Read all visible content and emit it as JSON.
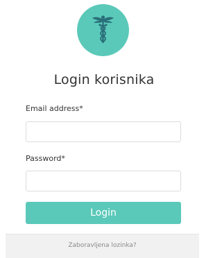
{
  "logo": {
    "icon": "caduceus-icon",
    "background_color": "#5bc9b9"
  },
  "login": {
    "title": "Login korisnika",
    "email_label": "Email address*",
    "email_value": "",
    "password_label": "Password*",
    "password_value": "",
    "submit_label": "Login",
    "forgot_password_link": "Zaboravljena lozinka?"
  },
  "colors": {
    "accent": "#5bc9b9",
    "footer_background": "#f1f1f1"
  }
}
